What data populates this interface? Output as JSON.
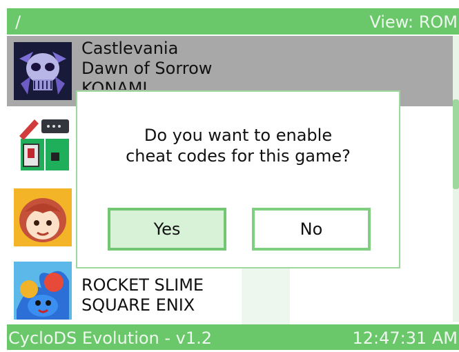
{
  "header": {
    "path": "/",
    "view_label": "View: ROM"
  },
  "games": [
    {
      "title": "Castlevania",
      "subtitle": "Dawn of Sorrow",
      "publisher": "KONAMI",
      "icon": "skull-icon",
      "selected": true
    },
    {
      "title": "",
      "subtitle": "",
      "publisher": "",
      "icon": "tools-icon",
      "selected": false
    },
    {
      "title": "",
      "subtitle": "",
      "publisher": "",
      "icon": "cooking-girl-icon",
      "selected": false
    },
    {
      "title": "",
      "subtitle": "ROCKET SLIME",
      "publisher": "SQUARE ENIX",
      "icon": "slime-icon",
      "selected": false
    }
  ],
  "dialog": {
    "line1": "Do you want to enable",
    "line2": "cheat codes for this game?",
    "yes_label": "Yes",
    "no_label": "No"
  },
  "footer": {
    "version": "CycloDS Evolution - v1.2",
    "time": "12:47:31 AM"
  },
  "colors": {
    "accent": "#6ac76a",
    "selection": "#a8a8a8",
    "button_border": "#80cf80"
  }
}
